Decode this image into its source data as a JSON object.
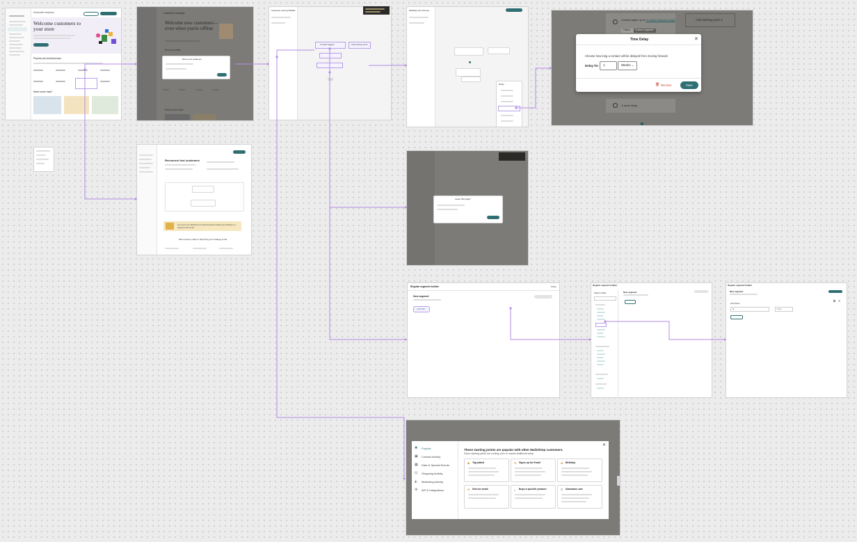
{
  "canvas": {
    "connector_color": "#b48ae6",
    "accent": "#2f6f73"
  },
  "frame_welcome": {
    "heading": "Welcome customers to your store",
    "top_label": "Automate business",
    "section_popular": "Popular pre-built journeys",
    "section_ready": "Need some help?"
  },
  "frame_welcome_offline": {
    "title": "Customer Journeys",
    "heading": "Welcome new customers—even when you're offline",
    "section": "Recent activity",
    "dialog_title": "Name your audience",
    "section2": "Need some help?"
  },
  "frame_builder_empty": {
    "title": "Customer Journey Builder",
    "trigger_chip": "Contact tagged",
    "add_chip": "Add starting point"
  },
  "frame_builder_actions": {
    "title": "Multistep test Journey",
    "menu_title": "Delay"
  },
  "time_delay_dialog": {
    "trigger_text_prefix": "Contact signs up to",
    "trigger_text_link": "Contacts Shopper Daily",
    "tabs": [
      "Filters",
      "Custom segment"
    ],
    "add_starting_point": "Add starting point 2",
    "title": "Time Delay",
    "description": "Choose how long a contact will be delayed from moving forward.",
    "delay_label": "Delay for",
    "delay_value": "1",
    "unit_value": "Weeks",
    "remove_label": "Remove",
    "save_label": "Save",
    "step_label": "1 week delay"
  },
  "frame_reconnect": {
    "heading": "Reconnect lost customers",
    "callout": "Get more from Mailchimp by learning about tracking and adding to a segment and email",
    "footer": "More journey maps to help bring your strategy to life"
  },
  "frame_confirm": {
    "dialog_title": "Leave this page?",
    "button": "Continue"
  },
  "frame_segment_builder": {
    "title": "Regular segment builder",
    "close": "Close",
    "segment_title": "New segment",
    "add_button": "+ Add filter"
  },
  "frame_segment_filters": {
    "title": "Regular segment builder",
    "panel_title": "Select a filter",
    "segment_title": "New segment"
  },
  "frame_segment_row": {
    "title": "Regular segment builder",
    "segment_title": "New segment",
    "row_label": "First Name",
    "operator": "is",
    "value": "Enter"
  },
  "starting_points": {
    "sidebar": [
      "Popular",
      "Contact Activity",
      "Date & Special Events",
      "Shopping Activity",
      "Marketing Activity",
      "API & Integrations"
    ],
    "heading": "These starting points are popular with other Mailchimp customers.",
    "subheading": "Some starting points are coming soon or require additional setup.",
    "cards": [
      {
        "title": "Tag added"
      },
      {
        "title": "Signs up for Email"
      },
      {
        "title": "Birthday"
      },
      {
        "title": "Sent an email"
      },
      {
        "title": "Buys a specific product"
      },
      {
        "title": "Abandons cart"
      }
    ]
  }
}
